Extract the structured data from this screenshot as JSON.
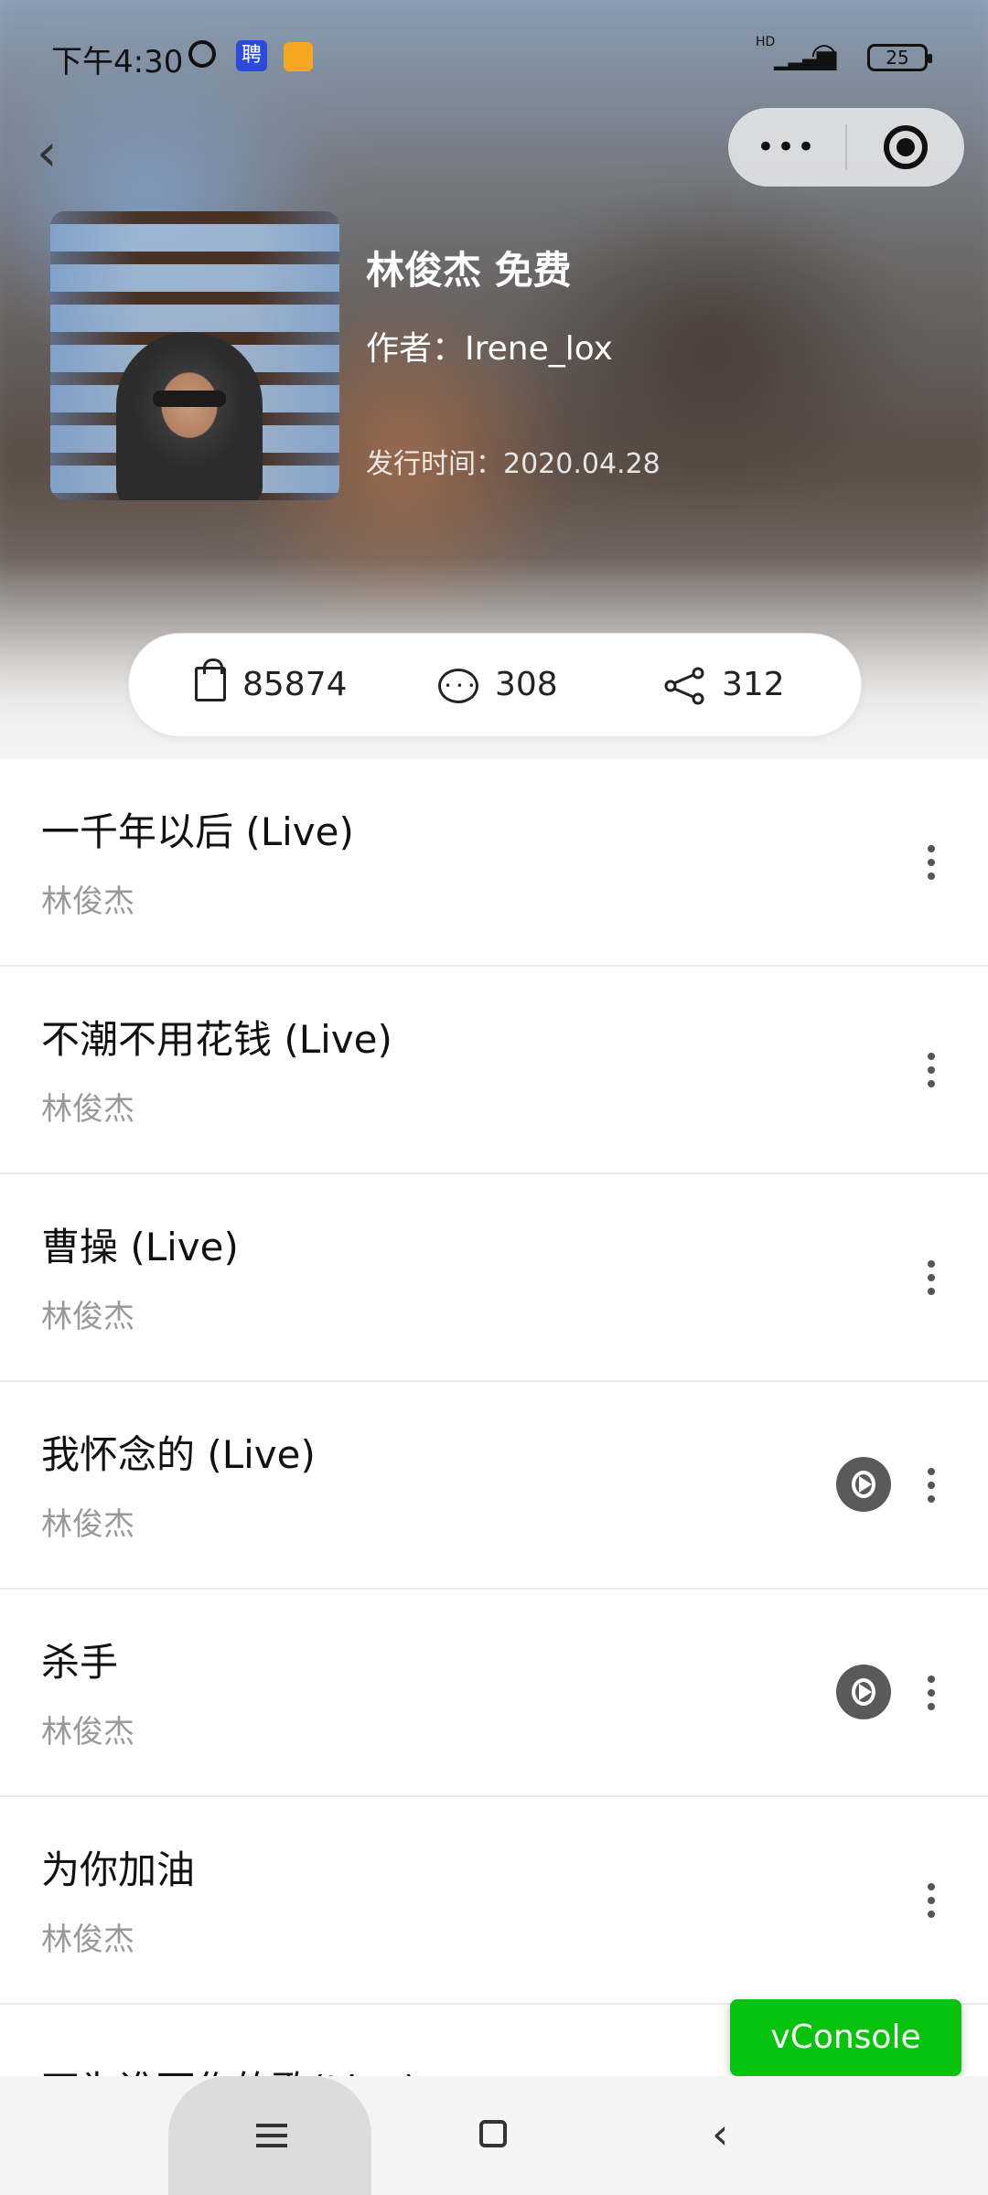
{
  "status_bar": {
    "time": "下午4:30",
    "app_icon_text": "聘",
    "signal_label": "HD",
    "battery": "25"
  },
  "nav": {
    "back_glyph": "‹",
    "more_glyph": "•••"
  },
  "album": {
    "title": "林俊杰 免费",
    "author": "作者：Irene_lox",
    "release": "发行时间：2020.04.28"
  },
  "stats": {
    "favorites": "85874",
    "comments": "308",
    "shares": "312"
  },
  "songs": [
    {
      "title": "一千年以后 (Live)",
      "artist": "林俊杰"
    },
    {
      "title": "不潮不用花钱 (Live)",
      "artist": "林俊杰"
    },
    {
      "title": "曹操 (Live)",
      "artist": "林俊杰"
    },
    {
      "title": "我怀念的 (Live)",
      "artist": "林俊杰"
    },
    {
      "title": "杀手",
      "artist": "林俊杰"
    },
    {
      "title": "为你加油",
      "artist": "林俊杰"
    },
    {
      "title": "不为谁而作的歌(Live)",
      "artist": ""
    }
  ],
  "vconsole": {
    "label": "vConsole"
  },
  "colors": {
    "vconsole_green": "#08c30d",
    "artist_gray": "#999999"
  }
}
